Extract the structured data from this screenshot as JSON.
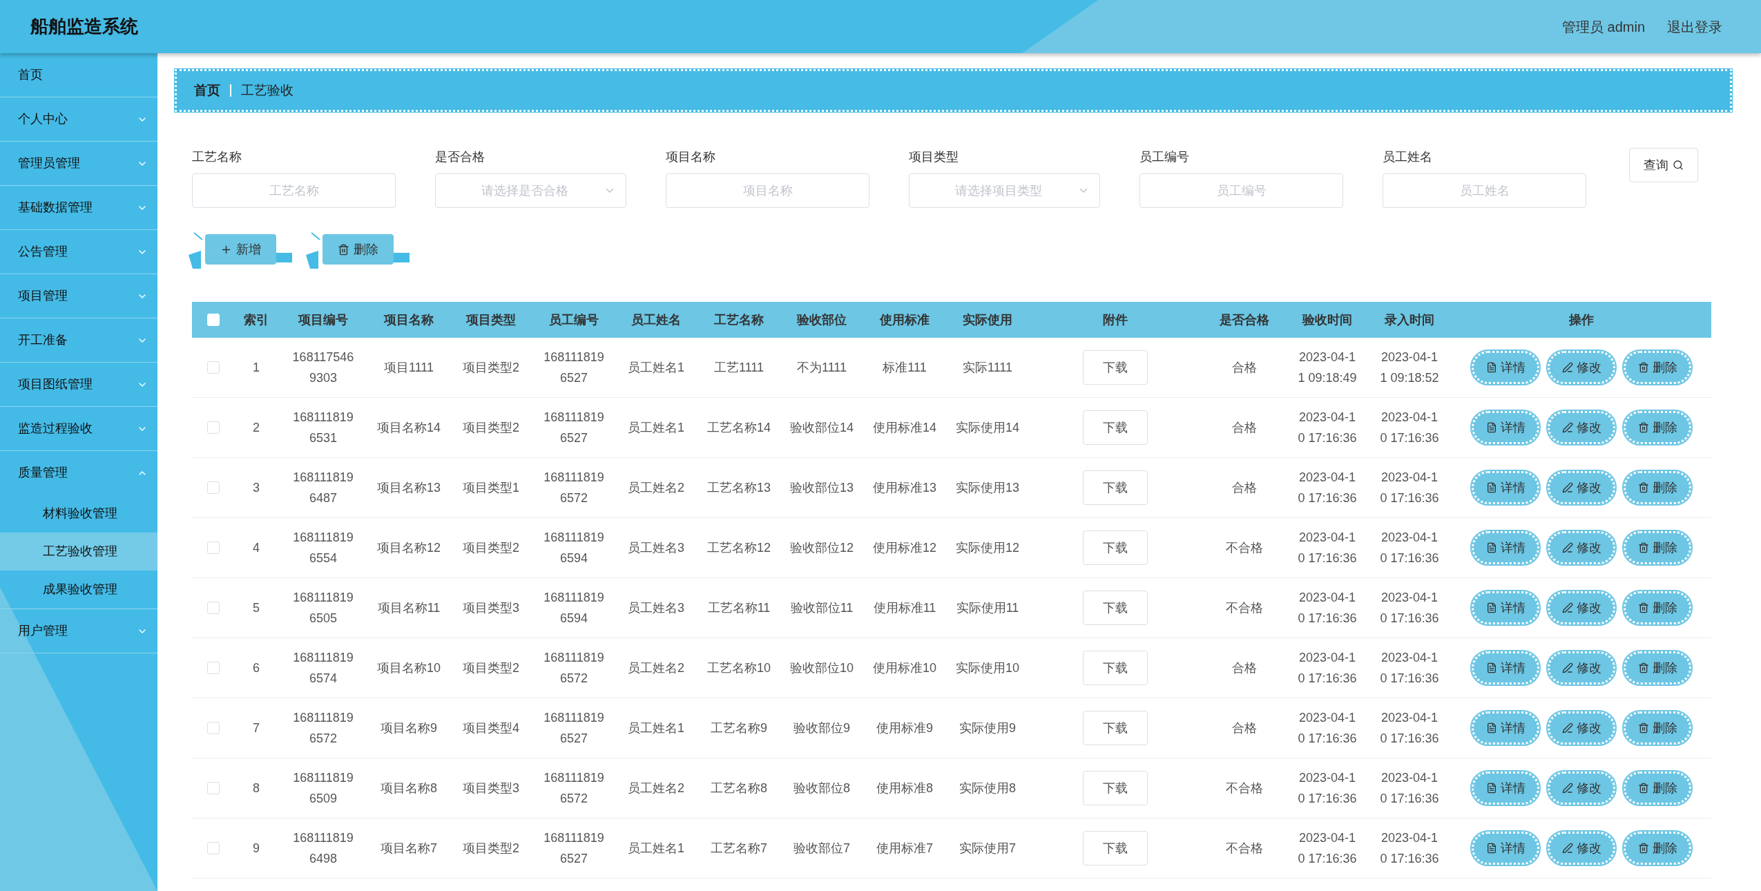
{
  "header": {
    "title": "船舶监造系统",
    "user": "管理员 admin",
    "logout": "退出登录"
  },
  "sidebar": {
    "items": [
      {
        "label": "首页",
        "selected": false
      },
      {
        "label": "个人中心",
        "selected": false,
        "expanded": false
      },
      {
        "label": "管理员管理",
        "selected": false,
        "expanded": false
      },
      {
        "label": "基础数据管理",
        "selected": false,
        "expanded": false
      },
      {
        "label": "公告管理",
        "selected": false,
        "expanded": false
      },
      {
        "label": "项目管理",
        "selected": false,
        "expanded": false
      },
      {
        "label": "开工准备",
        "selected": false,
        "expanded": false
      },
      {
        "label": "项目图纸管理",
        "selected": false,
        "expanded": false
      },
      {
        "label": "监造过程验收",
        "selected": false,
        "expanded": false
      },
      {
        "label": "质量管理",
        "selected": false,
        "expanded": true,
        "children": [
          {
            "label": "材料验收管理",
            "selected": false
          },
          {
            "label": "工艺验收管理",
            "selected": true
          },
          {
            "label": "成果验收管理",
            "selected": false
          }
        ]
      },
      {
        "label": "用户管理",
        "selected": false,
        "expanded": false
      }
    ]
  },
  "breadcrumb": [
    {
      "label": "首页"
    },
    {
      "label": "工艺验收"
    }
  ],
  "filters": [
    {
      "kind": "input",
      "label": "工艺名称",
      "placeholder": "工艺名称"
    },
    {
      "kind": "select",
      "label": "是否合格",
      "placeholder": "请选择是否合格"
    },
    {
      "kind": "input",
      "label": "项目名称",
      "placeholder": "项目名称"
    },
    {
      "kind": "select",
      "label": "项目类型",
      "placeholder": "请选择项目类型"
    },
    {
      "kind": "input",
      "label": "员工编号",
      "placeholder": "员工编号"
    },
    {
      "kind": "input",
      "label": "员工姓名",
      "placeholder": "员工姓名"
    }
  ],
  "search_button": "查询",
  "toolbar": [
    {
      "kind": "add",
      "label": "新增"
    },
    {
      "kind": "delete",
      "label": "删除"
    }
  ],
  "table": {
    "select_all": {
      "checked": false
    },
    "columns": [
      "索引",
      "项目编号",
      "项目名称",
      "项目类型",
      "员工编号",
      "员工姓名",
      "工艺名称",
      "验收部位",
      "使用标准",
      "实际使用",
      "附件",
      "是否合格",
      "验收时间",
      "录入时间",
      "操作"
    ],
    "rows": [
      {
        "checked": false,
        "cells": [
          "1",
          "1681175469303",
          "项目1111",
          "项目类型2",
          "1681118196527",
          "员工姓名1",
          "工艺1111",
          "不为1111",
          "标准111",
          "实际1111",
          "下载",
          "合格",
          "2023-04-11 09:18:49",
          "2023-04-11 09:18:52"
        ],
        "actions": [
          {
            "kind": "detail",
            "label": "详情"
          },
          {
            "kind": "edit",
            "label": "修改"
          },
          {
            "kind": "delete",
            "label": "删除"
          }
        ]
      },
      {
        "checked": false,
        "cells": [
          "2",
          "1681118196531",
          "项目名称14",
          "项目类型2",
          "1681118196527",
          "员工姓名1",
          "工艺名称14",
          "验收部位14",
          "使用标准14",
          "实际使用14",
          "下载",
          "合格",
          "2023-04-10 17:16:36",
          "2023-04-10 17:16:36"
        ],
        "actions": [
          {
            "kind": "detail",
            "label": "详情"
          },
          {
            "kind": "edit",
            "label": "修改"
          },
          {
            "kind": "delete",
            "label": "删除"
          }
        ]
      },
      {
        "checked": false,
        "cells": [
          "3",
          "1681118196487",
          "项目名称13",
          "项目类型1",
          "1681118196572",
          "员工姓名2",
          "工艺名称13",
          "验收部位13",
          "使用标准13",
          "实际使用13",
          "下载",
          "合格",
          "2023-04-10 17:16:36",
          "2023-04-10 17:16:36"
        ],
        "actions": [
          {
            "kind": "detail",
            "label": "详情"
          },
          {
            "kind": "edit",
            "label": "修改"
          },
          {
            "kind": "delete",
            "label": "删除"
          }
        ]
      },
      {
        "checked": false,
        "cells": [
          "4",
          "1681118196554",
          "项目名称12",
          "项目类型2",
          "1681118196594",
          "员工姓名3",
          "工艺名称12",
          "验收部位12",
          "使用标准12",
          "实际使用12",
          "下载",
          "不合格",
          "2023-04-10 17:16:36",
          "2023-04-10 17:16:36"
        ],
        "actions": [
          {
            "kind": "detail",
            "label": "详情"
          },
          {
            "kind": "edit",
            "label": "修改"
          },
          {
            "kind": "delete",
            "label": "删除"
          }
        ]
      },
      {
        "checked": false,
        "cells": [
          "5",
          "1681118196505",
          "项目名称11",
          "项目类型3",
          "1681118196594",
          "员工姓名3",
          "工艺名称11",
          "验收部位11",
          "使用标准11",
          "实际使用11",
          "下载",
          "不合格",
          "2023-04-10 17:16:36",
          "2023-04-10 17:16:36"
        ],
        "actions": [
          {
            "kind": "detail",
            "label": "详情"
          },
          {
            "kind": "edit",
            "label": "修改"
          },
          {
            "kind": "delete",
            "label": "删除"
          }
        ]
      },
      {
        "checked": false,
        "cells": [
          "6",
          "1681118196574",
          "项目名称10",
          "项目类型2",
          "1681118196572",
          "员工姓名2",
          "工艺名称10",
          "验收部位10",
          "使用标准10",
          "实际使用10",
          "下载",
          "合格",
          "2023-04-10 17:16:36",
          "2023-04-10 17:16:36"
        ],
        "actions": [
          {
            "kind": "detail",
            "label": "详情"
          },
          {
            "kind": "edit",
            "label": "修改"
          },
          {
            "kind": "delete",
            "label": "删除"
          }
        ]
      },
      {
        "checked": false,
        "cells": [
          "7",
          "1681118196572",
          "项目名称9",
          "项目类型4",
          "1681118196527",
          "员工姓名1",
          "工艺名称9",
          "验收部位9",
          "使用标准9",
          "实际使用9",
          "下载",
          "合格",
          "2023-04-10 17:16:36",
          "2023-04-10 17:16:36"
        ],
        "actions": [
          {
            "kind": "detail",
            "label": "详情"
          },
          {
            "kind": "edit",
            "label": "修改"
          },
          {
            "kind": "delete",
            "label": "删除"
          }
        ]
      },
      {
        "checked": false,
        "cells": [
          "8",
          "1681118196509",
          "项目名称8",
          "项目类型3",
          "1681118196572",
          "员工姓名2",
          "工艺名称8",
          "验收部位8",
          "使用标准8",
          "实际使用8",
          "下载",
          "不合格",
          "2023-04-10 17:16:36",
          "2023-04-10 17:16:36"
        ],
        "actions": [
          {
            "kind": "detail",
            "label": "详情"
          },
          {
            "kind": "edit",
            "label": "修改"
          },
          {
            "kind": "delete",
            "label": "删除"
          }
        ]
      },
      {
        "checked": false,
        "cells": [
          "9",
          "1681118196498",
          "项目名称7",
          "项目类型2",
          "1681118196527",
          "员工姓名1",
          "工艺名称7",
          "验收部位7",
          "使用标准7",
          "实际使用7",
          "下载",
          "不合格",
          "2023-04-10 17:16:36",
          "2023-04-10 17:16:36"
        ],
        "actions": [
          {
            "kind": "detail",
            "label": "详情"
          },
          {
            "kind": "edit",
            "label": "修改"
          },
          {
            "kind": "delete",
            "label": "删除"
          }
        ]
      }
    ]
  }
}
